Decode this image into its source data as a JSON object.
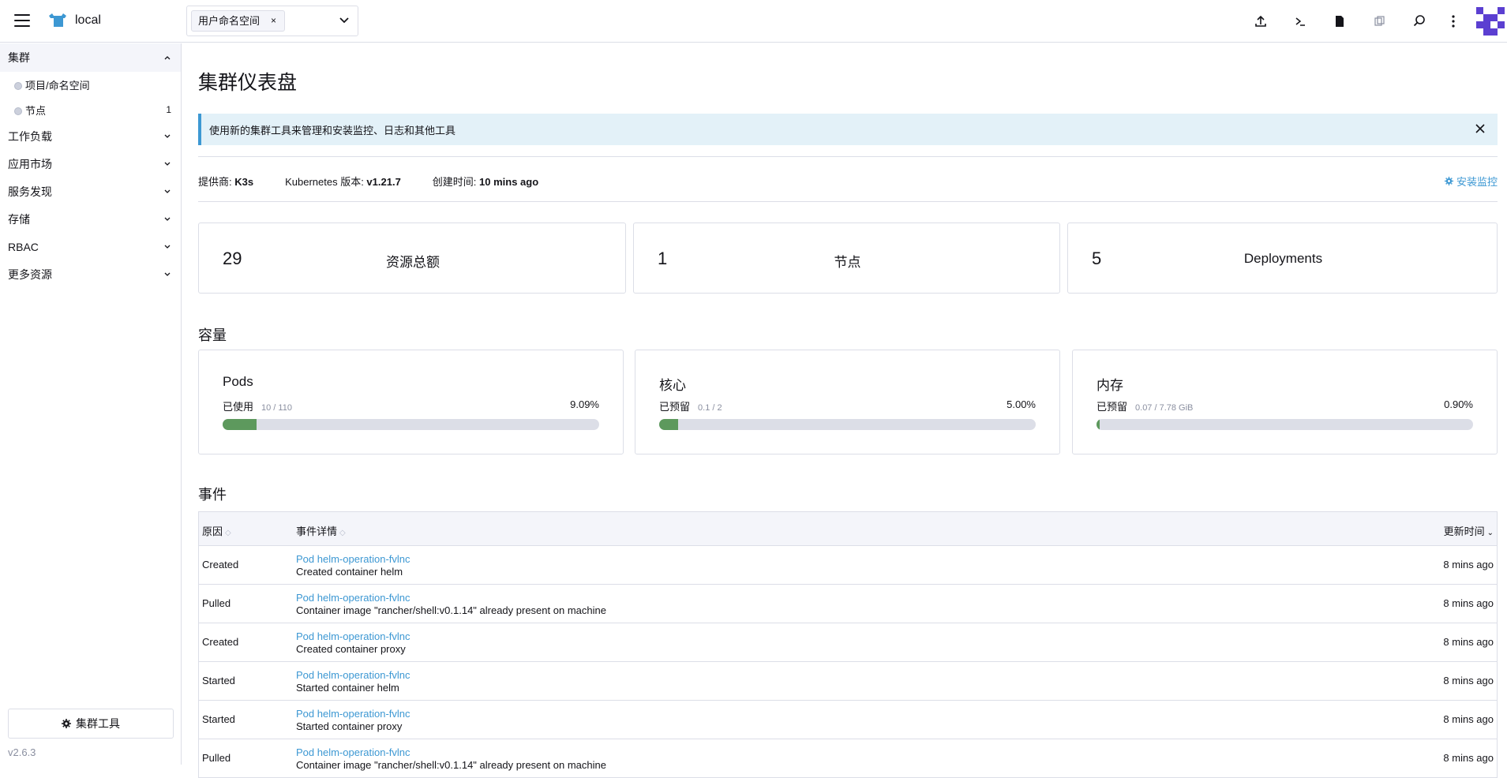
{
  "header": {
    "cluster_name": "local",
    "namespace_tag": "用户命名空间",
    "namespace_tag_remove": "×"
  },
  "sidebar": {
    "groups": [
      {
        "label": "集群",
        "expanded": true
      },
      {
        "label": "工作负载"
      },
      {
        "label": "应用市场"
      },
      {
        "label": "服务发现"
      },
      {
        "label": "存储"
      },
      {
        "label": "RBAC"
      },
      {
        "label": "更多资源"
      }
    ],
    "cluster_items": [
      {
        "label": "项目/命名空间",
        "count": ""
      },
      {
        "label": "节点",
        "count": "1"
      }
    ],
    "tools_button": "集群工具",
    "version": "v2.6.3"
  },
  "main": {
    "title": "集群仪表盘",
    "banner": "使用新的集群工具来管理和安装监控、日志和其他工具",
    "meta": {
      "provider_label": "提供商: ",
      "provider_value": "K3s",
      "k8s_label": "Kubernetes 版本: ",
      "k8s_value": "v1.21.7",
      "created_label": "创建时间: ",
      "created_value": "10 mins ago"
    },
    "install_monitoring": "安装监控",
    "counts": [
      {
        "number": "29",
        "label": "资源总额"
      },
      {
        "number": "1",
        "label": "节点"
      },
      {
        "number": "5",
        "label": "Deployments"
      }
    ],
    "capacity_title": "容量",
    "capacity": [
      {
        "title": "Pods",
        "used_label": "已使用",
        "detail": "10 / 110",
        "percent": "9.09%",
        "fraction": 0.0909
      },
      {
        "title": "核心",
        "used_label": "已预留",
        "detail": "0.1 / 2",
        "percent": "5.00%",
        "fraction": 0.05
      },
      {
        "title": "内存",
        "used_label": "已预留",
        "detail": "0.07 / 7.78 GiB",
        "percent": "0.90%",
        "fraction": 0.009
      }
    ],
    "events_title": "事件",
    "events_headers": {
      "reason": "原因",
      "detail": "事件详情",
      "time": "更新时间"
    },
    "events": [
      {
        "reason": "Created",
        "link": "Pod helm-operation-fvlnc",
        "detail": "Created container helm",
        "time": "8 mins ago"
      },
      {
        "reason": "Pulled",
        "link": "Pod helm-operation-fvlnc",
        "detail": "Container image \"rancher/shell:v0.1.14\" already present on machine",
        "time": "8 mins ago"
      },
      {
        "reason": "Created",
        "link": "Pod helm-operation-fvlnc",
        "detail": "Created container proxy",
        "time": "8 mins ago"
      },
      {
        "reason": "Started",
        "link": "Pod helm-operation-fvlnc",
        "detail": "Started container helm",
        "time": "8 mins ago"
      },
      {
        "reason": "Started",
        "link": "Pod helm-operation-fvlnc",
        "detail": "Started container proxy",
        "time": "8 mins ago"
      },
      {
        "reason": "Pulled",
        "link": "Pod helm-operation-fvlnc",
        "detail": "Container image \"rancher/shell:v0.1.14\" already present on machine",
        "time": "8 mins ago"
      }
    ]
  },
  "colors": {
    "accent": "#3d98d3",
    "progress": "#5d995d",
    "banner_bg": "#e3f1f8"
  }
}
